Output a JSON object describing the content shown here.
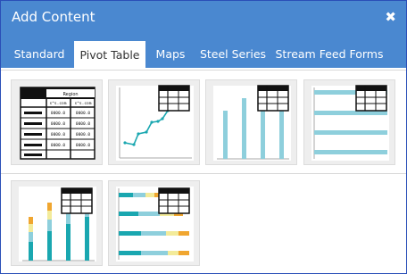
{
  "dialog": {
    "title": "Add Content",
    "close_symbol": "✖"
  },
  "tabs": [
    {
      "label": "Standard"
    },
    {
      "label": "Pivot Table"
    },
    {
      "label": "Maps"
    },
    {
      "label": "Steel Series"
    },
    {
      "label": "Stream Feed Forms"
    }
  ],
  "active_tab": "Pivot Table",
  "tiles": [
    {
      "name": "pivot-table-grid",
      "header_text": "Region",
      "col_text": "s^s.com",
      "cell_value": "0000.0"
    },
    {
      "name": "pivot-line-chart"
    },
    {
      "name": "pivot-column-chart"
    },
    {
      "name": "pivot-bar-chart"
    },
    {
      "name": "pivot-stacked-column-chart"
    },
    {
      "name": "pivot-stacked-bar-chart"
    }
  ],
  "colors": {
    "header_blue": "#4a88d0",
    "series_teal": "#1aa7b0",
    "series_light_blue": "#8ecfdc",
    "series_orange": "#f0a630",
    "series_yellow": "#f3eb9a"
  }
}
